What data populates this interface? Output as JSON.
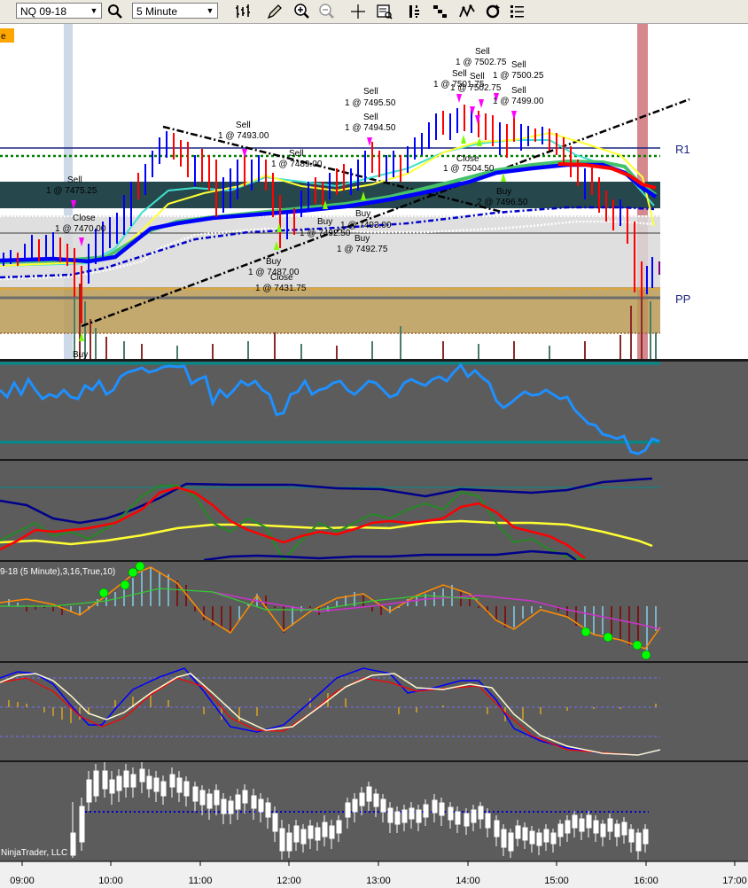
{
  "toolbar": {
    "instrument": "NQ 09-18",
    "interval": "5 Minute",
    "icons": [
      "search-icon",
      "bar-type-icon",
      "draw-icon",
      "zoom-in-icon",
      "zoom-out-icon",
      "crosshair-icon",
      "data-box-icon",
      "properties-icon",
      "strategies-icon",
      "chart-trader-icon",
      "refresh-icon",
      "list-icon"
    ]
  },
  "chart": {
    "corner_label": "e",
    "levels": {
      "r1": "R1",
      "pp": "PP"
    },
    "indicator_label": "9-18 (5 Minute),3,16,True,10)",
    "watermark": "NinjaTrader, LLC",
    "time_axis": [
      "09:00",
      "10:00",
      "11:00",
      "12:00",
      "13:00",
      "14:00",
      "15:00",
      "16:00",
      "17:00"
    ],
    "colors": {
      "bg": "#ffffff",
      "panel": "#5c5c5c",
      "up_bar": "#0000ff",
      "down_bar": "#ff0000",
      "sell_marker": "#ff00ff",
      "buy_marker": "#00ff00"
    },
    "trade_labels": [
      {
        "id": "sell-1",
        "line1": "Sell",
        "line2": "1 @ 7475.25"
      },
      {
        "id": "close-1",
        "line1": "Close",
        "line2": "1 @ 7470.00"
      },
      {
        "id": "sell-2",
        "line1": "Sell",
        "line2": "1 @ 7493.00"
      },
      {
        "id": "sell-3",
        "line1": "Sell",
        "line2": "1 @ 7489.00"
      },
      {
        "id": "buy-1",
        "line1": "Buy",
        "line2": "1 @ 7487.00"
      },
      {
        "id": "close-2",
        "line1": "Close",
        "line2": "1 @ 7431.75"
      },
      {
        "id": "buy-2",
        "line1": "Buy",
        "line2": "1 @ 7492.50"
      },
      {
        "id": "buy-3",
        "line1": "Buy",
        "line2": "1 @ 7493.00"
      },
      {
        "id": "buy-4",
        "line1": "Buy",
        "line2": "1 @ 7492.75"
      },
      {
        "id": "sell-4",
        "line1": "Sell",
        "line2": "1 @ 7495.50"
      },
      {
        "id": "sell-5",
        "line1": "Sell",
        "line2": "1 @ 7494.50"
      },
      {
        "id": "sell-6",
        "line1": "Sell",
        "line2": "1 @ 7502.75"
      },
      {
        "id": "sell-7",
        "line1": "Sell",
        "line2": "1 @ 7501.75"
      },
      {
        "id": "sell-8",
        "line1": "Sell",
        "line2": "1 @ 7502.75"
      },
      {
        "id": "sell-9",
        "line1": "Sell",
        "line2": "1 @ 7500.25"
      },
      {
        "id": "sell-10",
        "line1": "Sell",
        "line2": "1 @ 7499.00"
      },
      {
        "id": "close-3",
        "line1": "Close",
        "line2": "1 @ 7504.50"
      },
      {
        "id": "buy-5",
        "line1": "Buy",
        "line2": "2 @ 7496.50"
      },
      {
        "id": "buy-6",
        "line1": "Buy",
        "line2": ""
      }
    ]
  }
}
